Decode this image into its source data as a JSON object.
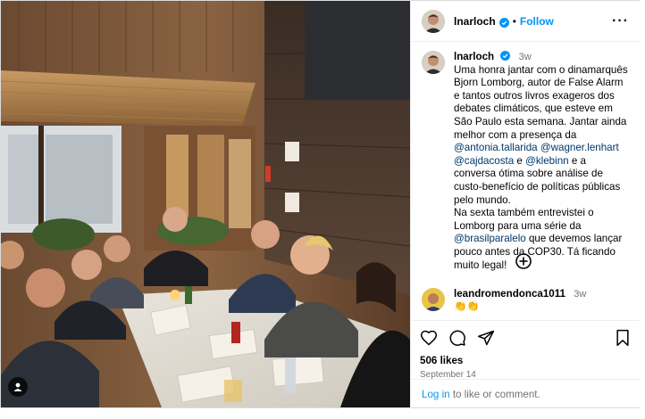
{
  "post": {
    "username": "lnarloch",
    "follow_label": "Follow",
    "separator": "•",
    "more_label": "···",
    "photo_alt": "Group of nine people at a long restaurant table"
  },
  "caption": {
    "username": "lnarloch",
    "time": "3w",
    "segments": [
      {
        "text": "Uma honra jantar com o dinamarquês Bjorn Lomborg, autor de False Alarm e tantos outros livros exageros dos debates climáticos, que esteve em São Paulo esta semana. Jantar ainda melhor com a presença da ",
        "mention": false
      },
      {
        "text": "@antonia.tallarida",
        "mention": true
      },
      {
        "text": " ",
        "mention": false
      },
      {
        "text": "@wagner.lenhart",
        "mention": true
      },
      {
        "text": " ",
        "mention": false
      },
      {
        "text": "@cajdacosta",
        "mention": true
      },
      {
        "text": " e ",
        "mention": false
      },
      {
        "text": "@klebinn",
        "mention": true
      },
      {
        "text": " e a conversa ótima sobre análise de custo-benefício de políticas públicas pelo mundo.",
        "mention": false
      }
    ],
    "segments2": [
      {
        "text": "Na sexta também entrevistei o Lomborg para uma série da ",
        "mention": false
      },
      {
        "text": "@brasilparalelo",
        "mention": true
      },
      {
        "text": " que devemos lançar pouco antes da COP30. Tá ficando muito legal!",
        "mention": false
      }
    ]
  },
  "comment": {
    "username": "leandromendonca1011",
    "time": "3w",
    "text": "👏👏"
  },
  "stats": {
    "likes": "506 likes",
    "date": "September 14"
  },
  "login": {
    "link": "Log in",
    "rest": " to like or comment."
  },
  "colors": {
    "accent": "#0095f6",
    "mention": "#00376b",
    "muted": "#737373",
    "verified": "#0095f6"
  },
  "icons": [
    "more-options-icon",
    "verified-icon",
    "add-comment-icon",
    "heart-icon",
    "comment-icon",
    "share-icon",
    "bookmark-icon",
    "user-tag-icon"
  ]
}
